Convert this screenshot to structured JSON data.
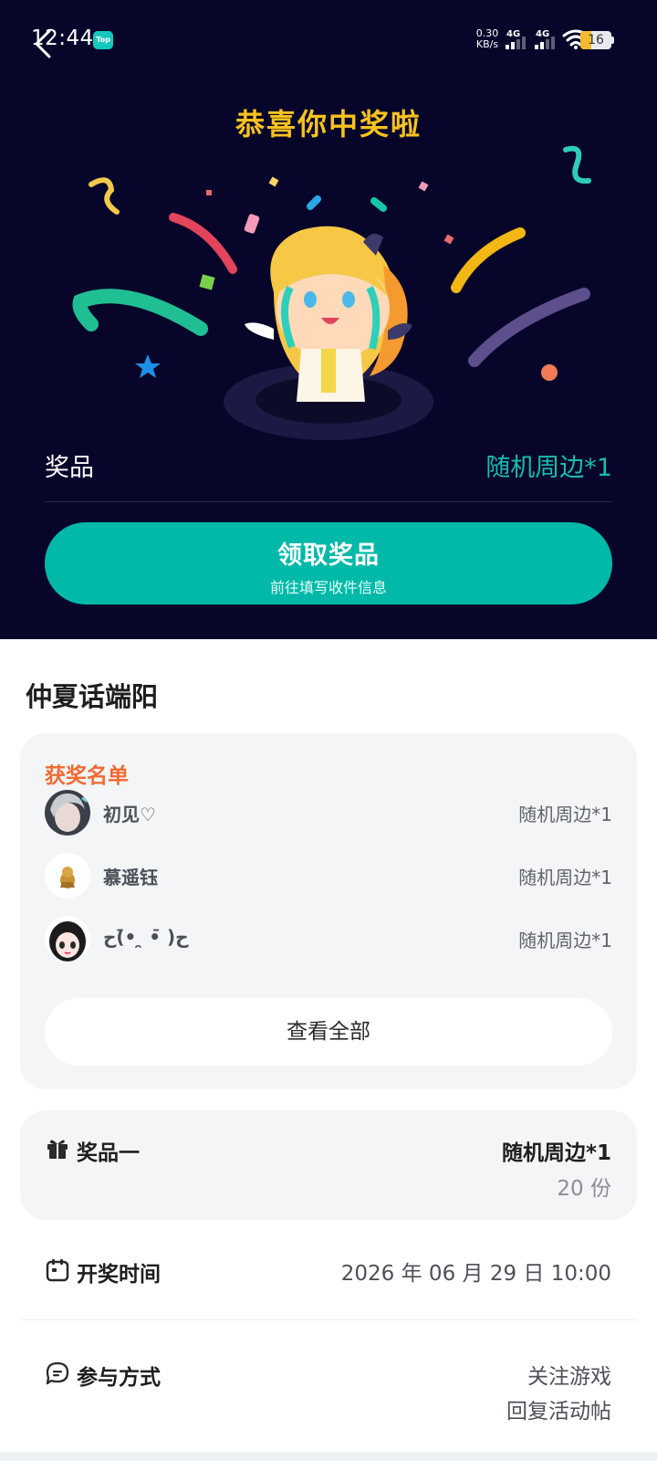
{
  "status_bar": {
    "time": "12:44",
    "app_badge": "Top",
    "net_speed_value": "0.30",
    "net_speed_unit": "KB/s",
    "signal_1_label": "4G",
    "signal_2_label": "4G",
    "battery_level": "16"
  },
  "hero": {
    "title": "恭喜你中奖啦",
    "prize_label": "奖品",
    "prize_value": "随机周边*1",
    "claim_button_label": "领取奖品",
    "claim_button_sublabel": "前往填写收件信息"
  },
  "event": {
    "title": "仲夏话端阳"
  },
  "winners": {
    "heading": "获奖名单",
    "list": [
      {
        "name": "初见♡",
        "prize": "随机周边*1"
      },
      {
        "name": "慕遥钰",
        "prize": "随机周边*1"
      },
      {
        "name": "ح( ̄•  ̯ •̄)ح",
        "prize": "随机周边*1"
      }
    ],
    "view_all_label": "查看全部"
  },
  "prize_info": {
    "label": "奖品一",
    "item": "随机周边*1",
    "count": "20 份"
  },
  "draw_time": {
    "label": "开奖时间",
    "value": "2026 年 06 月 29 日 10:00"
  },
  "participation": {
    "label": "参与方式",
    "values": [
      "关注游戏",
      "回复活动帖"
    ]
  },
  "colors": {
    "hero_bg": "#07062a",
    "accent_teal": "#00b9a9",
    "title_yellow": "#f8c21f",
    "winners_orange": "#f06a32"
  }
}
